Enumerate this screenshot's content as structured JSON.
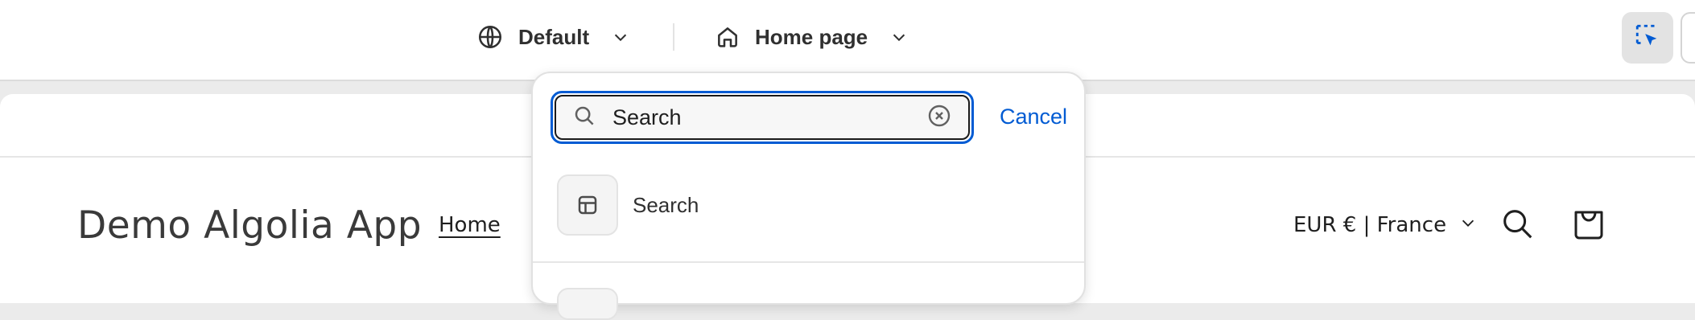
{
  "topbar": {
    "market_selector": {
      "label": "Default",
      "icon": "globe-icon"
    },
    "page_selector": {
      "label": "Home page",
      "icon": "home-icon"
    },
    "inspector": {
      "icon": "inspector-select-icon"
    }
  },
  "preview": {
    "store_title": "Demo Algolia App",
    "nav": {
      "home_label": "Home"
    },
    "currency_label": "EUR € | France",
    "icons": [
      "search-icon",
      "cart-icon"
    ]
  },
  "popover": {
    "search": {
      "value": "Search",
      "placeholder": ""
    },
    "cancel_label": "Cancel",
    "results": [
      {
        "label": "Search",
        "icon": "template-icon"
      }
    ]
  },
  "colors": {
    "accent": "#005bd3",
    "focus_border": "#005bd3",
    "text": "#303030"
  }
}
